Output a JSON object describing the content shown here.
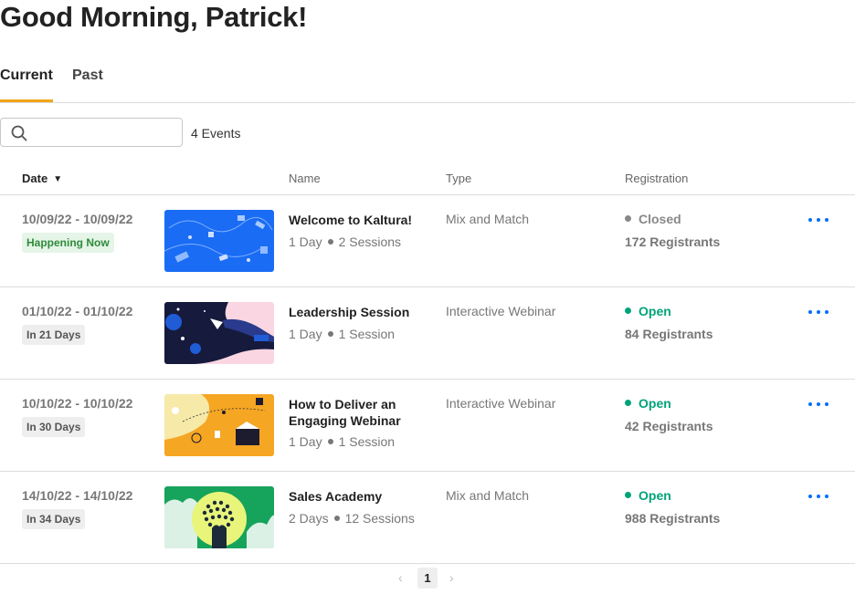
{
  "page": {
    "greeting": "Good Morning, Patrick!"
  },
  "tabs": [
    {
      "label": "Current",
      "active": true
    },
    {
      "label": "Past",
      "active": false
    }
  ],
  "search": {
    "placeholder": "",
    "value": "",
    "icon": "search-icon"
  },
  "event_count": "4 Events",
  "table": {
    "headers": {
      "date": "Date",
      "name": "Name",
      "type": "Type",
      "registration": "Registration"
    },
    "rows": [
      {
        "date_range": "10/09/22 - 10/09/22",
        "badge": "Happening Now",
        "badge_kind": "live",
        "name": "Welcome to Kaltura!",
        "duration": "1 Day",
        "sessions": "2 Sessions",
        "type": "Mix and Match",
        "status": "Closed",
        "status_kind": "closed",
        "registrants": "172 Registrants"
      },
      {
        "date_range": "01/10/22 - 01/10/22",
        "badge": "In 21 Days",
        "badge_kind": "upcoming",
        "name": "Leadership Session",
        "duration": "1 Day",
        "sessions": "1 Session",
        "type": "Interactive Webinar",
        "status": "Open",
        "status_kind": "open",
        "registrants": "84 Registrants"
      },
      {
        "date_range": "10/10/22 - 10/10/22",
        "badge": "In 30 Days",
        "badge_kind": "upcoming",
        "name": "How to Deliver an Engaging Webinar",
        "duration": "1 Day",
        "sessions": "1 Session",
        "type": "Interactive Webinar",
        "status": "Open",
        "status_kind": "open",
        "registrants": "42 Registrants"
      },
      {
        "date_range": "14/10/22 - 14/10/22",
        "badge": "In 34 Days",
        "badge_kind": "upcoming",
        "name": "Sales Academy",
        "duration": "2 Days",
        "sessions": "12 Sessions",
        "type": "Mix and Match",
        "status": "Open",
        "status_kind": "open",
        "registrants": "988 Registrants"
      }
    ]
  },
  "pagination": {
    "current_page": "1",
    "prev_icon": "chevron-left-icon",
    "next_icon": "chevron-right-icon"
  },
  "colors": {
    "accent_tab": "#f2a417",
    "open_status": "#00a37a",
    "closed_status": "#888888",
    "link_blue": "#006efa",
    "live_badge_bg": "#e5f5e8",
    "live_badge_text": "#2e8b3a"
  }
}
